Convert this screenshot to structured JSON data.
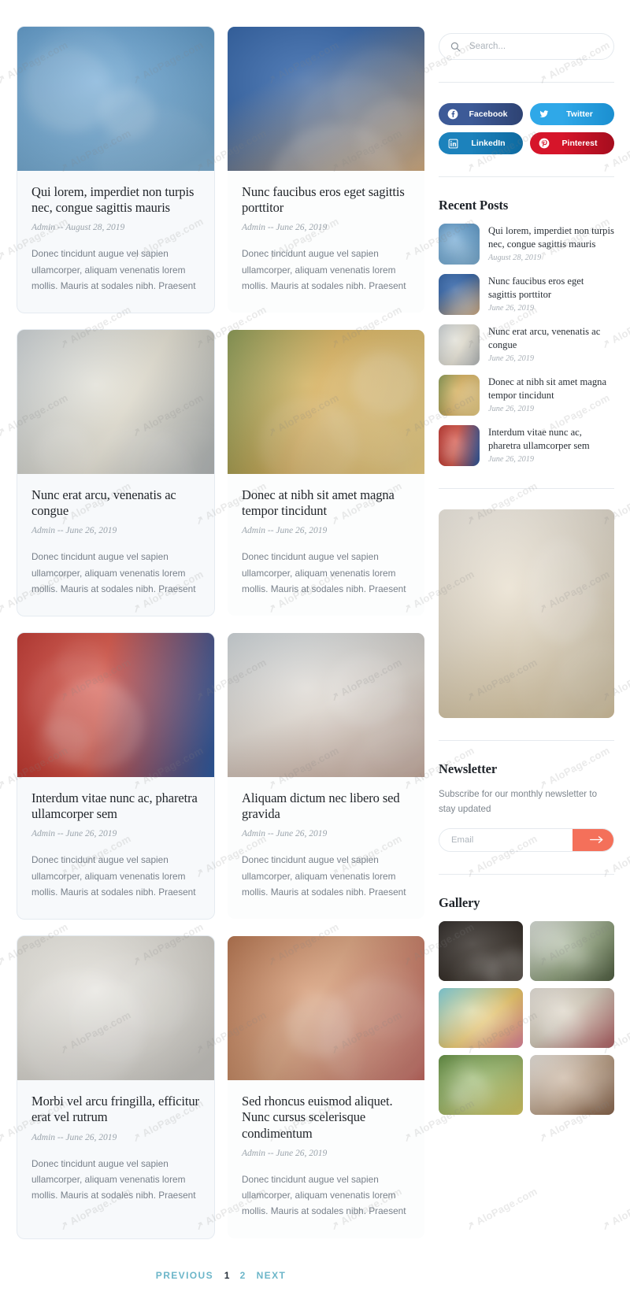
{
  "search": {
    "placeholder": "Search...",
    "value": "",
    "icon": "search-icon"
  },
  "social": [
    {
      "name": "Facebook",
      "icon": "facebook-icon",
      "color": "#3d5a97",
      "color2": "#2e4373"
    },
    {
      "name": "Twitter",
      "icon": "twitter-icon",
      "color": "#2fa8e8",
      "color2": "#1b8fd0"
    },
    {
      "name": "LinkedIn",
      "icon": "linkedin-icon",
      "color": "#1c82bc",
      "color2": "#0e6aa0"
    },
    {
      "name": "Pinterest",
      "icon": "pinterest-icon",
      "color": "#d6152a",
      "color2": "#a50d1e"
    }
  ],
  "recent": {
    "title": "Recent Posts",
    "items": [
      {
        "title": "Qui lorem, imperdiet non turpis nec, congue sagittis mauris",
        "date": "August 28, 2019"
      },
      {
        "title": "Nunc faucibus eros eget sagittis porttitor",
        "date": "June 26, 2019"
      },
      {
        "title": "Nunc erat arcu, venenatis ac congue",
        "date": "June 26, 2019"
      },
      {
        "title": "Donec at nibh sit amet magna tempor tincidunt",
        "date": "June 26, 2019"
      },
      {
        "title": "Interdum vitae nunc ac, pharetra ullamcorper sem",
        "date": "June 26, 2019"
      }
    ]
  },
  "newsletter": {
    "title": "Newsletter",
    "description": "Subscribe for our monthly newsletter to stay updated",
    "placeholder": "Email",
    "value": "",
    "submit_icon": "arrow-right-icon",
    "submit_color": "#f4705a"
  },
  "gallery": {
    "title": "Gallery",
    "items": [
      "girl-astronaut-chalkboard",
      "teen-and-child-science-robot",
      "girl-cardboard-helmet-star",
      "two-girls-painted-hands",
      "group-of-teens-outdoors",
      "boy-playing-guitar"
    ]
  },
  "posts": [
    {
      "title": "Qui lorem, imperdiet non turpis nec, congue sagittis mauris",
      "meta": "Admin -- August 28, 2019",
      "excerpt": "Donec tincidunt augue vel sapien ullamcorper, aliquam venenatis lorem mollis. Mauris at sodales nibh. Praesent",
      "image": "boy-with-vr-headset-balloons"
    },
    {
      "title": "Nunc faucibus eros eget sagittis porttitor",
      "meta": "Admin -- June 26, 2019",
      "excerpt": "Donec tincidunt augue vel sapien ullamcorper, aliquam venenatis lorem mollis. Mauris at sodales nibh. Praesent",
      "image": "girl-writing-at-school-desk"
    },
    {
      "title": "Nunc erat arcu, venenatis ac congue",
      "meta": "Admin -- June 26, 2019",
      "excerpt": "Donec tincidunt augue vel sapien ullamcorper, aliquam venenatis lorem mollis. Mauris at sodales nibh. Praesent",
      "image": "child-coloring-book"
    },
    {
      "title": "Donec at nibh sit amet magna tempor tincidunt",
      "meta": "Admin -- June 26, 2019",
      "excerpt": "Donec tincidunt augue vel sapien ullamcorper, aliquam venenatis lorem mollis. Mauris at sodales nibh. Praesent",
      "image": "two-girls-reading-book-sunset"
    },
    {
      "title": "Interdum vitae nunc ac, pharetra ullamcorper sem",
      "meta": "Admin -- June 26, 2019",
      "excerpt": "Donec tincidunt augue vel sapien ullamcorper, aliquam venenatis lorem mollis. Mauris at sodales nibh. Praesent",
      "image": "kids-in-superhero-masks"
    },
    {
      "title": "Aliquam dictum nec libero sed gravida",
      "meta": "Admin -- June 26, 2019",
      "excerpt": "Donec tincidunt augue vel sapien ullamcorper, aliquam venenatis lorem mollis. Mauris at sodales nibh. Praesent",
      "image": "girl-with-craft-table"
    },
    {
      "title": "Morbi vel arcu fringilla, efficitur erat vel rutrum",
      "meta": "Admin -- June 26, 2019",
      "excerpt": "Donec tincidunt augue vel sapien ullamcorper, aliquam venenatis lorem mollis. Mauris at sodales nibh. Praesent",
      "image": "hand-coloring-with-markers"
    },
    {
      "title": "Sed rhoncus euismod aliquet. Nunc cursus scelerisque condimentum",
      "meta": "Admin -- June 26, 2019",
      "excerpt": "Donec tincidunt augue vel sapien ullamcorper, aliquam venenatis lorem mollis. Mauris at sodales nibh. Praesent",
      "image": "girl-in-pink-writing"
    }
  ],
  "pagination": {
    "previous": "PREVIOUS",
    "pages": [
      "1",
      "2"
    ],
    "current": "1",
    "next": "NEXT",
    "color": "#6cb6c9",
    "active_color": "#26303a"
  },
  "watermark": {
    "text": "AloPage.com"
  }
}
